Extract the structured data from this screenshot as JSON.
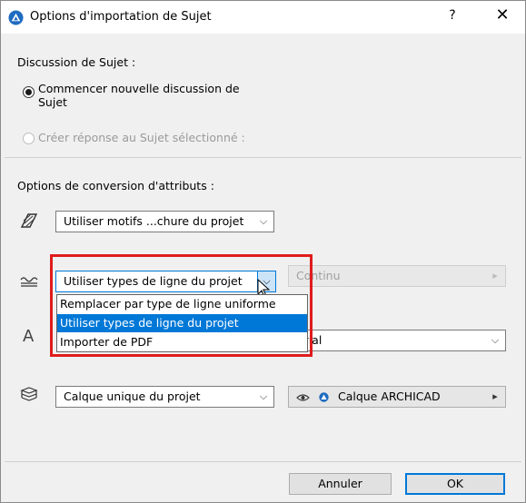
{
  "window": {
    "title": "Options d'importation de Sujet",
    "help_label": "?",
    "close_label": "✕",
    "icon": "archicad-logo-icon"
  },
  "discussion": {
    "heading": "Discussion de Sujet :",
    "option_new_line1": "Commencer nouvelle discussion de",
    "option_new_line2": "Sujet",
    "option_reply": "Créer réponse au Sujet sélectionné :",
    "selected": "new"
  },
  "conversion": {
    "heading": "Options de conversion d'attributs :",
    "hatch": {
      "icon": "hatch-pattern-icon",
      "value": "Utiliser motifs ...chure du projet"
    },
    "line": {
      "icon": "line-type-icon",
      "value": "Utiliser types de ligne du projet",
      "secondary_value": "Continu",
      "options": [
        "Remplacer par type de ligne uniforme",
        "Utiliser types de ligne du projet",
        "Importer de PDF"
      ],
      "selected_index": 1
    },
    "font": {
      "icon": "font-icon",
      "icon_glyph": "A",
      "value": "Arial"
    },
    "layer": {
      "icon": "layers-icon",
      "value": "Calque unique du projet",
      "layer_name": "Calque ARCHICAD"
    }
  },
  "buttons": {
    "cancel": "Annuler",
    "ok": "OK"
  },
  "colors": {
    "accent": "#0078d7",
    "highlight_box": "#e01c1c"
  }
}
